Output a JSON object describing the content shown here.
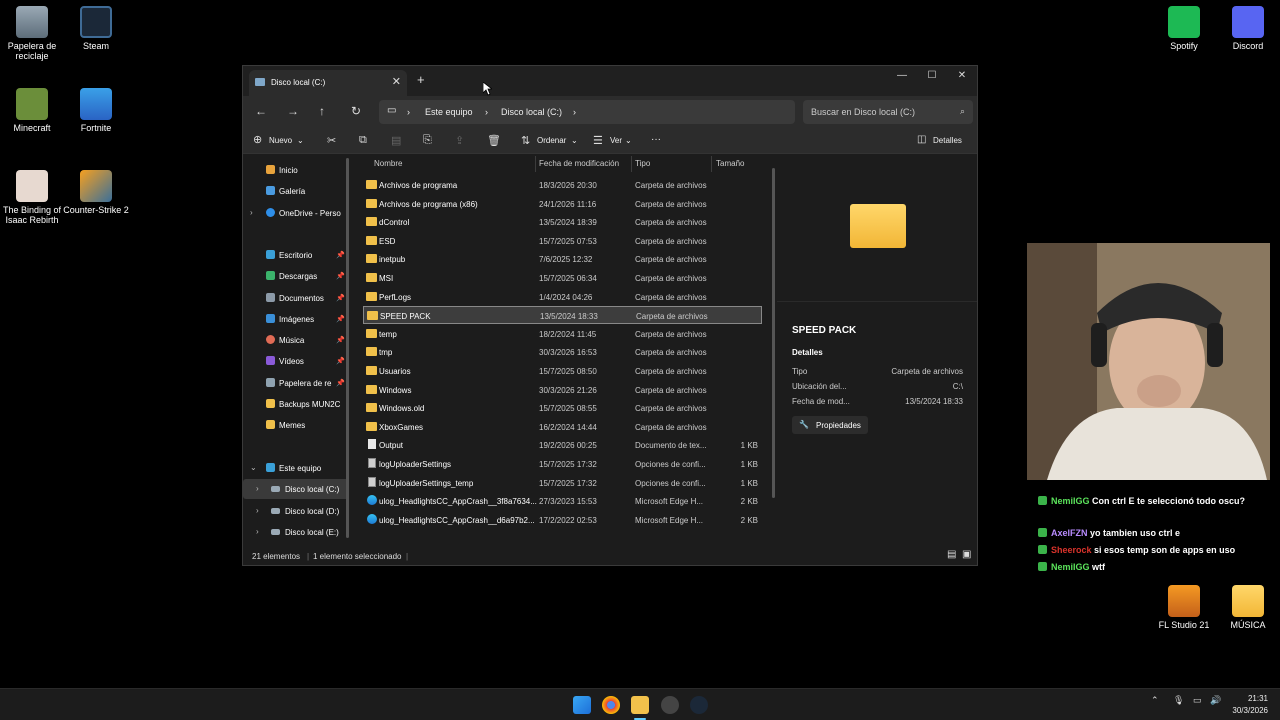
{
  "desktop": {
    "icons_left": [
      {
        "label": "Papelera de reciclaje",
        "icon": "recycle-bin-icon"
      },
      {
        "label": "Steam",
        "icon": "steam-icon"
      },
      {
        "label": "Minecraft",
        "icon": "minecraft-icon"
      },
      {
        "label": "Fortnite",
        "icon": "fortnite-icon"
      },
      {
        "label": "The Binding of Isaac Rebirth",
        "icon": "isaac-icon"
      },
      {
        "label": "Counter-Strike 2",
        "icon": "counter-strike-icon"
      }
    ],
    "icons_right": [
      {
        "label": "Spotify",
        "icon": "spotify-icon"
      },
      {
        "label": "Discord",
        "icon": "discord-icon"
      },
      {
        "label": "FL Studio 21",
        "icon": "fl-studio-icon"
      },
      {
        "label": "MÚSICA",
        "icon": "folder-icon"
      }
    ]
  },
  "explorer": {
    "tab_title": "Disco local (C:)",
    "new_tab": "+",
    "breadcrumb": [
      "Este equipo",
      "Disco local (C:)"
    ],
    "search_placeholder": "Buscar en Disco local (C:)",
    "toolbar": {
      "new_label": "Nuevo",
      "sort_label": "Ordenar",
      "view_label": "Ver",
      "more_label": "···",
      "details_label": "Detalles"
    },
    "nav_items": [
      {
        "label": "Inicio",
        "icon": "home-icon",
        "color": "#e8a33c"
      },
      {
        "label": "Galería",
        "icon": "gallery-icon",
        "color": "#4a9be0"
      },
      {
        "label": "OneDrive - Perso",
        "icon": "onedrive-icon",
        "color": "#2e8ee8"
      },
      {
        "label": "Escritorio",
        "icon": "desktop-icon",
        "color": "#3aa0d8"
      },
      {
        "label": "Descargas",
        "icon": "download-icon",
        "color": "#3bb36b"
      },
      {
        "label": "Documentos",
        "icon": "documents-icon",
        "color": "#8c9aa8"
      },
      {
        "label": "Imágenes",
        "icon": "pictures-icon",
        "color": "#3a8fd8"
      },
      {
        "label": "Música",
        "icon": "music-icon",
        "color": "#e06b55"
      },
      {
        "label": "Vídeos",
        "icon": "videos-icon",
        "color": "#8a5ad8"
      },
      {
        "label": "Papelera de re",
        "icon": "recycle-bin-icon",
        "color": "#8fa2b0"
      },
      {
        "label": "Backups MUN2C",
        "icon": "folder-icon",
        "color": "#f0c04a"
      },
      {
        "label": "Memes",
        "icon": "folder-icon",
        "color": "#f0c04a"
      },
      {
        "label": "Este equipo",
        "icon": "this-pc-icon",
        "color": "#3aa0d8"
      },
      {
        "label": "Disco local (C:)",
        "icon": "drive-icon",
        "color": "#9aa9b5"
      },
      {
        "label": "Disco local (D:)",
        "icon": "drive-icon",
        "color": "#9aa9b5"
      },
      {
        "label": "Disco local (E:)",
        "icon": "drive-icon",
        "color": "#9aa9b5"
      }
    ],
    "columns": [
      "Nombre",
      "Fecha de modificación",
      "Tipo",
      "Tamaño"
    ],
    "rows": [
      {
        "name": "Archivos de programa",
        "date": "18/3/2026 20:30",
        "type": "Carpeta de archivos",
        "size": "",
        "icon": "folder"
      },
      {
        "name": "Archivos de programa (x86)",
        "date": "24/1/2026 11:16",
        "type": "Carpeta de archivos",
        "size": "",
        "icon": "folder"
      },
      {
        "name": "dControl",
        "date": "13/5/2024 18:39",
        "type": "Carpeta de archivos",
        "size": "",
        "icon": "folder"
      },
      {
        "name": "ESD",
        "date": "15/7/2025 07:53",
        "type": "Carpeta de archivos",
        "size": "",
        "icon": "folder"
      },
      {
        "name": "inetpub",
        "date": "7/6/2025 12:32",
        "type": "Carpeta de archivos",
        "size": "",
        "icon": "folder"
      },
      {
        "name": "MSI",
        "date": "15/7/2025 06:34",
        "type": "Carpeta de archivos",
        "size": "",
        "icon": "folder"
      },
      {
        "name": "PerfLogs",
        "date": "1/4/2024 04:26",
        "type": "Carpeta de archivos",
        "size": "",
        "icon": "folder"
      },
      {
        "name": "SPEED PACK",
        "date": "13/5/2024 18:33",
        "type": "Carpeta de archivos",
        "size": "",
        "icon": "folder"
      },
      {
        "name": "temp",
        "date": "18/2/2024 11:45",
        "type": "Carpeta de archivos",
        "size": "",
        "icon": "folder"
      },
      {
        "name": "tmp",
        "date": "30/3/2026 16:53",
        "type": "Carpeta de archivos",
        "size": "",
        "icon": "folder"
      },
      {
        "name": "Usuarios",
        "date": "15/7/2025 08:50",
        "type": "Carpeta de archivos",
        "size": "",
        "icon": "folder"
      },
      {
        "name": "Windows",
        "date": "30/3/2026 21:26",
        "type": "Carpeta de archivos",
        "size": "",
        "icon": "folder"
      },
      {
        "name": "Windows.old",
        "date": "15/7/2025 08:55",
        "type": "Carpeta de archivos",
        "size": "",
        "icon": "folder"
      },
      {
        "name": "XboxGames",
        "date": "16/2/2024 14:44",
        "type": "Carpeta de archivos",
        "size": "",
        "icon": "folder"
      },
      {
        "name": "Output",
        "date": "19/2/2026 00:25",
        "type": "Documento de tex...",
        "size": "1 KB",
        "icon": "doc"
      },
      {
        "name": "logUploaderSettings",
        "date": "15/7/2025 17:32",
        "type": "Opciones de confi...",
        "size": "1 KB",
        "icon": "cfg"
      },
      {
        "name": "logUploaderSettings_temp",
        "date": "15/7/2025 17:32",
        "type": "Opciones de confi...",
        "size": "1 KB",
        "icon": "cfg"
      },
      {
        "name": "ulog_HeadlightsCC_AppCrash__3f8a7634...",
        "date": "27/3/2023 15:53",
        "type": "Microsoft Edge H...",
        "size": "2 KB",
        "icon": "edge"
      },
      {
        "name": "ulog_HeadlightsCC_AppCrash__d6a97b2...",
        "date": "17/2/2022 02:53",
        "type": "Microsoft Edge H...",
        "size": "2 KB",
        "icon": "edge"
      }
    ],
    "details": {
      "name": "SPEED PACK",
      "section": "Detalles",
      "fields": [
        {
          "label": "Tipo",
          "value": "Carpeta de archivos"
        },
        {
          "label": "Ubicación del...",
          "value": "C:\\"
        },
        {
          "label": "Fecha de mod...",
          "value": "13/5/2024 18:33"
        }
      ],
      "properties_label": "Propiedades"
    },
    "status": {
      "count": "21 elementos",
      "selected": "1 elemento seleccionado"
    }
  },
  "chat": [
    {
      "user": "NemiIGG",
      "user_color": "#5be35b",
      "text": "Con ctrl E te seleccionó todo oscu?"
    },
    {
      "user": "AxelFZN",
      "user_color": "#b98cff",
      "text": "yo tambien uso ctrl e"
    },
    {
      "user": "Sheerock",
      "user_color": "#d9332b",
      "text": "si esos temp son de apps en uso"
    },
    {
      "user": "NemiIGG",
      "user_color": "#5be35b",
      "text": "wtf"
    }
  ],
  "taskbar": {
    "time": "21:31",
    "date": "30/3/2026"
  }
}
